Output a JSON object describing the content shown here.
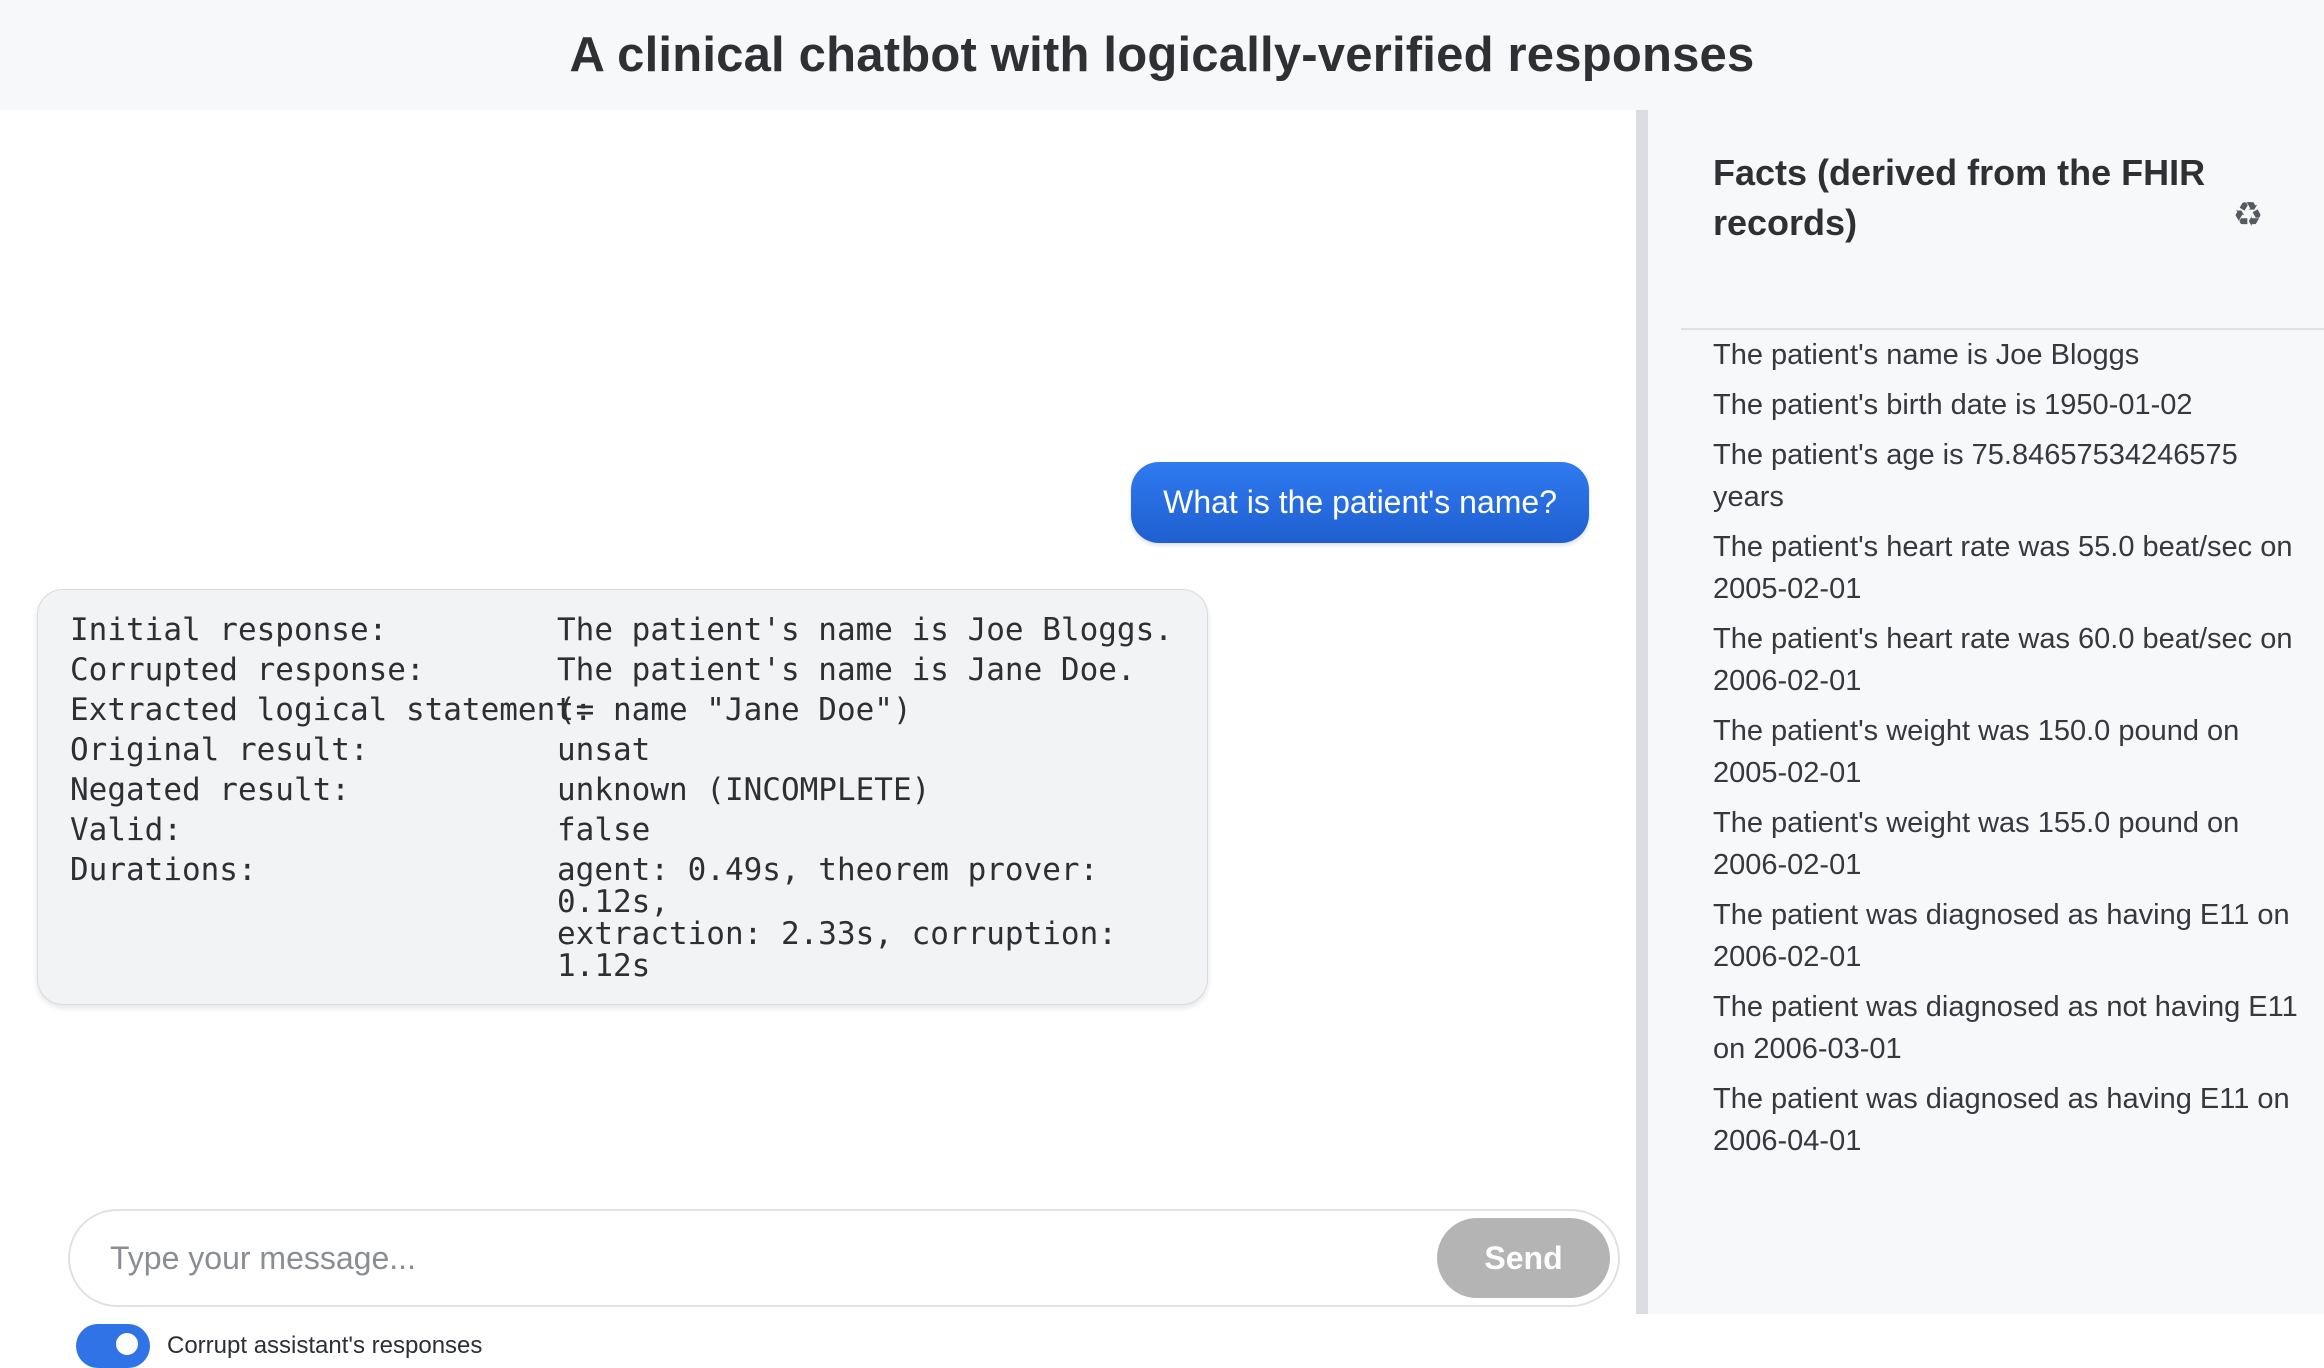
{
  "header": {
    "title": "A clinical chatbot with logically-verified responses"
  },
  "chat": {
    "user_message": "What is the patient's name?",
    "assistant_message": {
      "rows": [
        {
          "key": "Initial response:",
          "value": "The patient's name is Joe Bloggs."
        },
        {
          "key": "Corrupted response:",
          "value": "The patient's name is Jane Doe."
        },
        {
          "key": "Extracted logical statement:",
          "value": "(= name \"Jane Doe\")"
        },
        {
          "key": "Original result:",
          "value": "unsat"
        },
        {
          "key": "Negated result:",
          "value": "unknown (INCOMPLETE)"
        },
        {
          "key": "Valid:",
          "value": "false"
        },
        {
          "key": "Durations:",
          "value": "agent: 0.49s, theorem prover: 0.12s,\nextraction: 2.33s, corruption: 1.12s"
        }
      ]
    },
    "input": {
      "placeholder": "Type your message...",
      "value": ""
    },
    "send_label": "Send",
    "corrupt_toggle": {
      "label": "Corrupt assistant's responses",
      "on": true,
      "color": "#2f73e6"
    }
  },
  "facts": {
    "title": "Facts (derived from the FHIR records)",
    "refresh_icon": "recycle-icon",
    "items": [
      "The patient's name is Joe Bloggs",
      "The patient's birth date is 1950-01-02",
      "The patient's age is 75.84657534246575 years",
      "The patient's heart rate was 55.0 beat/sec on 2005-02-01",
      "The patient's heart rate was 60.0 beat/sec on 2006-02-01",
      "The patient's weight was 150.0 pound on 2005-02-01",
      "The patient's weight was 155.0 pound on 2006-02-01",
      "The patient was diagnosed as having E11 on 2006-02-01",
      "The patient was diagnosed as not having E11 on 2006-03-01",
      "The patient was diagnosed as having E11 on 2006-04-01"
    ]
  },
  "colors": {
    "accent": "#2f73e6",
    "send_disabled": "#b4b4b4"
  }
}
